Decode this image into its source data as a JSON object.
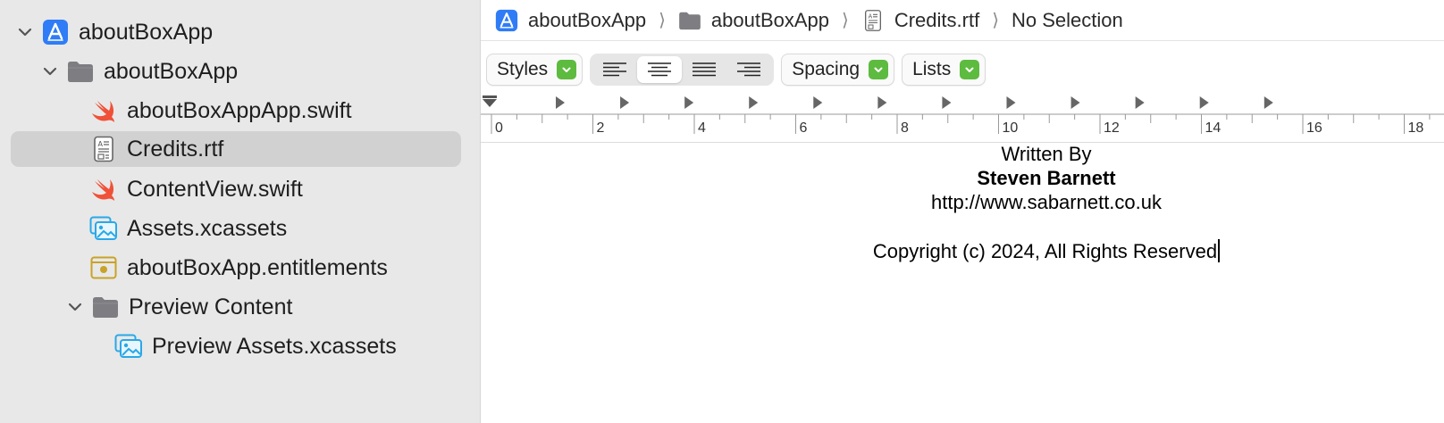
{
  "sidebar": {
    "items": [
      {
        "label": "aboutBoxApp",
        "icon": "app-icon"
      },
      {
        "label": "aboutBoxApp",
        "icon": "folder-icon"
      },
      {
        "label": "aboutBoxAppApp.swift",
        "icon": "swift-icon"
      },
      {
        "label": "Credits.rtf",
        "icon": "rtf-document-icon",
        "selected": true
      },
      {
        "label": "ContentView.swift",
        "icon": "swift-icon"
      },
      {
        "label": "Assets.xcassets",
        "icon": "asset-catalog-icon"
      },
      {
        "label": "aboutBoxApp.entitlements",
        "icon": "entitlements-icon"
      },
      {
        "label": "Preview Content",
        "icon": "folder-icon"
      },
      {
        "label": "Preview Assets.xcassets",
        "icon": "asset-catalog-icon"
      }
    ]
  },
  "breadcrumb": {
    "items": [
      {
        "label": "aboutBoxApp",
        "icon": "app-icon"
      },
      {
        "label": "aboutBoxApp",
        "icon": "folder-icon"
      },
      {
        "label": "Credits.rtf",
        "icon": "rtf-document-icon"
      },
      {
        "label": "No Selection"
      }
    ]
  },
  "toolbar": {
    "styles_label": "Styles",
    "spacing_label": "Spacing",
    "lists_label": "Lists",
    "alignments": [
      "align-left",
      "align-center",
      "align-justify",
      "align-right"
    ],
    "active_alignment": "align-center"
  },
  "ruler": {
    "labels": [
      "0",
      "2",
      "4",
      "6",
      "8",
      "10",
      "12",
      "14",
      "16",
      "18"
    ]
  },
  "document": {
    "lines": [
      {
        "text": "Written By",
        "bold": false
      },
      {
        "text": "Steven Barnett",
        "bold": true
      },
      {
        "text": "http://www.sabarnett.co.uk",
        "bold": false
      },
      {
        "text": "",
        "bold": false
      },
      {
        "text": "Copyright (c) 2024, All Rights Reserved",
        "bold": false
      }
    ]
  },
  "colors": {
    "sidebar_bg": "#e8e8e8",
    "selection_bg": "#d1d1d1",
    "accent_green": "#5dbb3f",
    "app_icon_blue": "#2f7cf6",
    "swift_orange": "#f05138",
    "folder_gray": "#7d7d82",
    "asset_blue": "#29a8e8",
    "entitlements_gold": "#c9a227"
  }
}
